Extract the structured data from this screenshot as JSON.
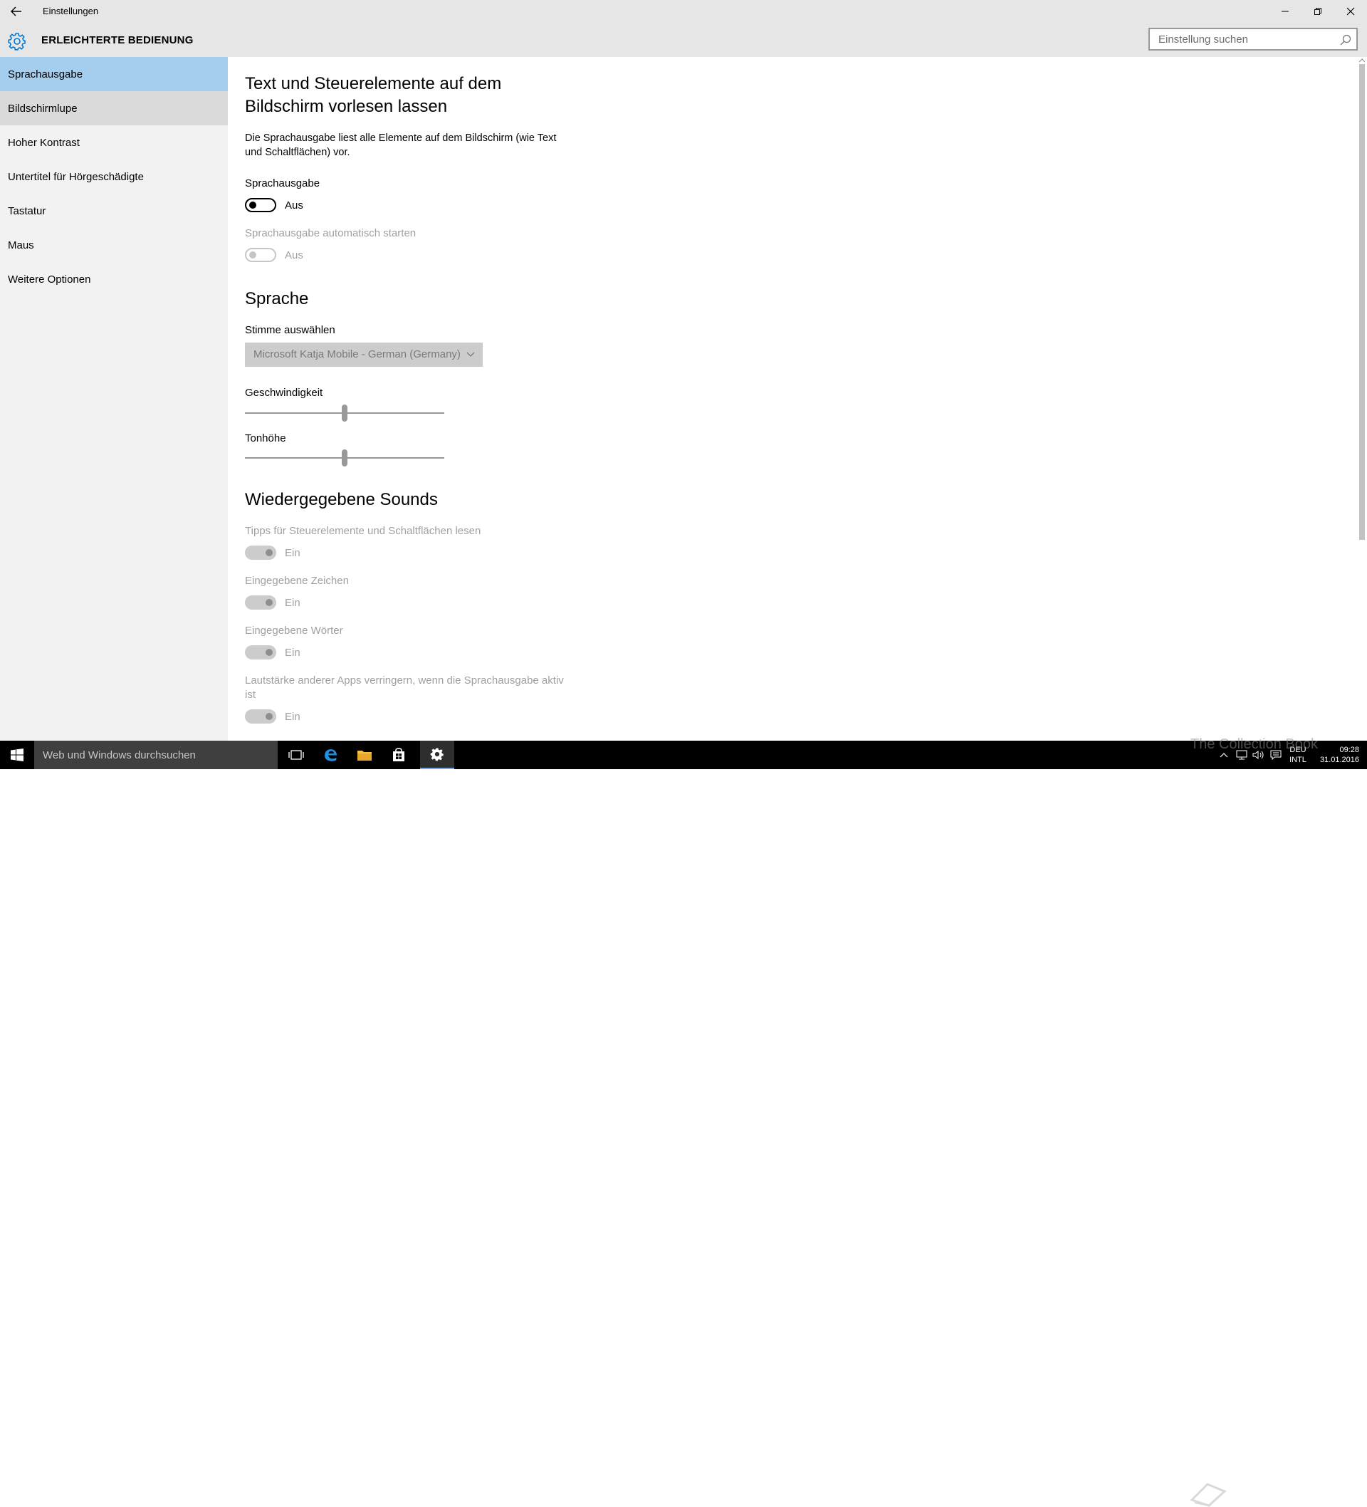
{
  "window": {
    "title": "Einstellungen",
    "section_title": "ERLEICHTERTE BEDIENUNG",
    "search_placeholder": "Einstellung suchen"
  },
  "sidebar": {
    "items": [
      {
        "label": "Sprachausgabe",
        "state": "selected"
      },
      {
        "label": "Bildschirmlupe",
        "state": "hover"
      },
      {
        "label": "Hoher Kontrast",
        "state": "normal"
      },
      {
        "label": "Untertitel für Hörgeschädigte",
        "state": "normal"
      },
      {
        "label": "Tastatur",
        "state": "normal"
      },
      {
        "label": "Maus",
        "state": "normal"
      },
      {
        "label": "Weitere Optionen",
        "state": "normal"
      }
    ]
  },
  "main": {
    "heading": "Text und Steuerelemente auf dem Bildschirm vorlesen lassen",
    "description": "Die Sprachausgabe liest alle Elemente auf dem Bildschirm (wie Text und Schaltflächen) vor.",
    "narrator": {
      "label": "Sprachausgabe",
      "state_text": "Aus",
      "on": false
    },
    "autostart": {
      "label": "Sprachausgabe automatisch starten",
      "state_text": "Aus",
      "on": false,
      "disabled": true
    },
    "language_heading": "Sprache",
    "voice": {
      "label": "Stimme auswählen",
      "value": "Microsoft Katja Mobile - German (Germany)"
    },
    "speed": {
      "label": "Geschwindigkeit",
      "value_pct": 50
    },
    "pitch": {
      "label": "Tonhöhe",
      "value_pct": 50
    },
    "sounds_heading": "Wiedergegebene Sounds",
    "sounds": [
      {
        "label": "Tipps für Steuerelemente und Schaltflächen lesen",
        "state_text": "Ein",
        "on": true
      },
      {
        "label": "Eingegebene Zeichen",
        "state_text": "Ein",
        "on": true
      },
      {
        "label": "Eingegebene Wörter",
        "state_text": "Ein",
        "on": true
      },
      {
        "label": "Lautstärke anderer Apps verringern, wenn die Sprachausgabe aktiv ist",
        "state_text": "Ein",
        "on": true
      }
    ]
  },
  "taskbar": {
    "search_text": "Web und Windows durchsuchen",
    "lang_top": "DEU",
    "lang_bottom": "INTL",
    "time": "09:28",
    "date": "31.01.2016",
    "watermark": "The Collection Book"
  },
  "icons": {
    "back": "back-arrow-icon",
    "gear": "gear-icon",
    "search": "search-icon",
    "minimize": "minimize-icon",
    "restore": "restore-icon",
    "close": "close-icon"
  },
  "colors": {
    "selected_nav": "#a4cdee",
    "hover_nav": "#dadada",
    "sidebar_bg": "#f2f2f2",
    "titlebar_bg": "#e6e6e6",
    "accent": "#0078d7"
  }
}
